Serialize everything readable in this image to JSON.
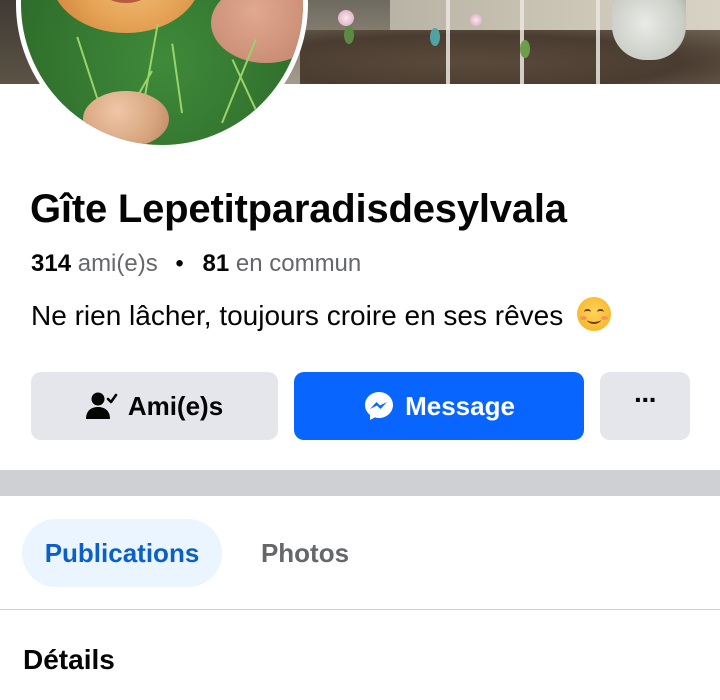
{
  "profile": {
    "name": "Gîte Lepetitparadisdesylvala",
    "friends_count": "314",
    "friends_label": "ami(e)s",
    "separator": "•",
    "mutual_count": "81",
    "mutual_label": "en commun",
    "bio": "Ne rien lâcher, toujours croire en ses rêves",
    "bio_emoji": "smiling-face-with-smiling-eyes"
  },
  "actions": {
    "friends_label": "Ami(e)s",
    "friends_icon": "friends-check-icon",
    "message_label": "Message",
    "message_icon": "messenger-icon",
    "more_label": "···",
    "accent_color": "#0866ff"
  },
  "tabs": [
    {
      "label": "Publications",
      "selected": true
    },
    {
      "label": "Photos",
      "selected": false
    }
  ],
  "sections": {
    "details_title": "Détails"
  }
}
